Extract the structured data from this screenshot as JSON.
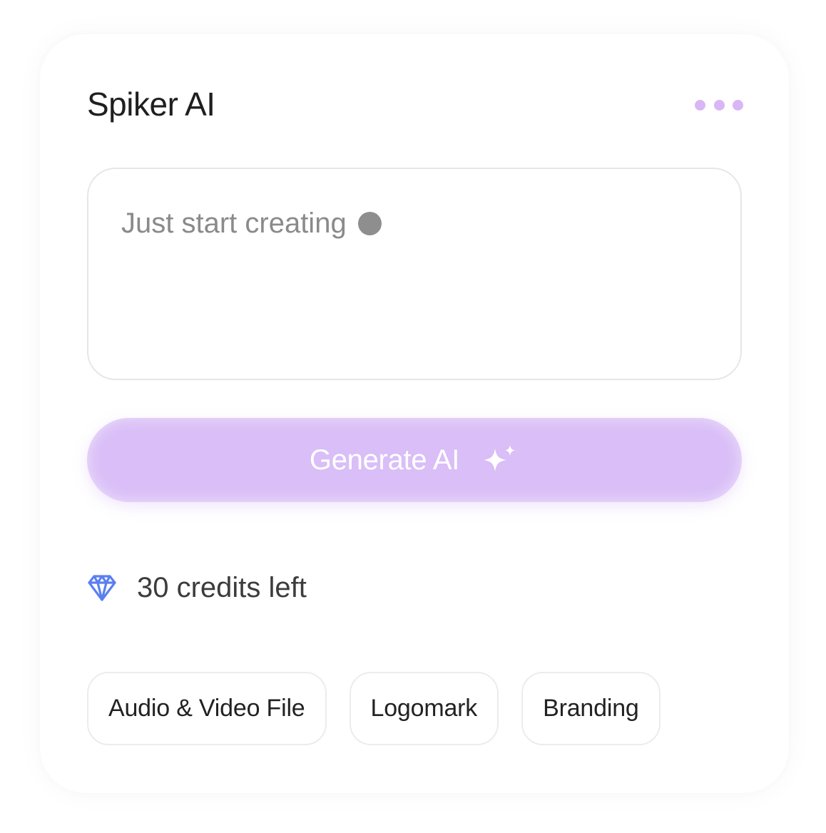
{
  "widget": {
    "title": "Spiker AI"
  },
  "prompt": {
    "placeholder": "Just start creating"
  },
  "generate_button": {
    "label": "Generate AI",
    "icon": "sparkles-icon"
  },
  "credits": {
    "icon": "diamond-icon",
    "text": "30 credits left"
  },
  "chips": [
    {
      "label": "Audio & Video File"
    },
    {
      "label": "Logomark"
    },
    {
      "label": "Branding"
    }
  ],
  "colors": {
    "accent": "#d9bef7",
    "more_dots": "#d9b6f5",
    "diamond": "#5b7ff0",
    "title": "#1f1f1f",
    "placeholder": "#8a8a8a"
  }
}
